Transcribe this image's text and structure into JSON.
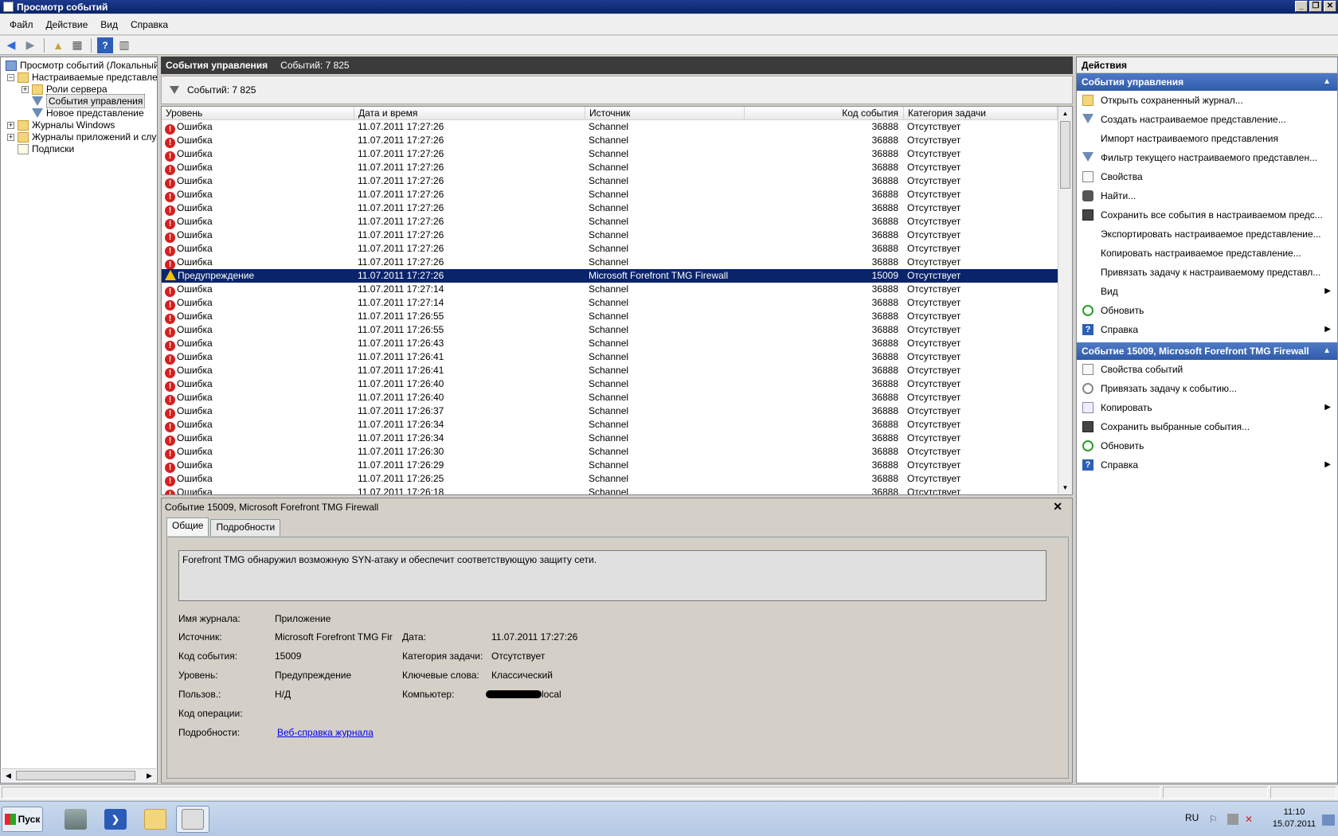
{
  "window": {
    "title": "Просмотр событий"
  },
  "menu": [
    "Файл",
    "Действие",
    "Вид",
    "Справка"
  ],
  "tree": [
    {
      "label": "Просмотр событий (Локальный)",
      "level": 0,
      "expander": "",
      "icon": "computer"
    },
    {
      "label": "Настраиваемые представлени",
      "level": 0,
      "expander": "−",
      "icon": "folder"
    },
    {
      "label": "Роли сервера",
      "level": 1,
      "expander": "+",
      "icon": "folder"
    },
    {
      "label": "События управления",
      "level": 1,
      "expander": "",
      "icon": "filter",
      "selected": true
    },
    {
      "label": "Новое представление",
      "level": 1,
      "expander": "",
      "icon": "filter"
    },
    {
      "label": "Журналы Windows",
      "level": 0,
      "expander": "+",
      "icon": "folder"
    },
    {
      "label": "Журналы приложений и служ",
      "level": 0,
      "expander": "+",
      "icon": "folder"
    },
    {
      "label": "Подписки",
      "level": 0,
      "expander": "",
      "icon": "doc"
    }
  ],
  "center": {
    "header_title": "События управления",
    "header_count": "Событий: 7 825",
    "filter_count": "Событий: 7 825"
  },
  "columns": [
    "Уровень",
    "Дата и время",
    "Источник",
    "Код события",
    "Категория задачи"
  ],
  "events": [
    {
      "level": "Ошибка",
      "datetime": "11.07.2011 17:27:26",
      "source": "Schannel",
      "code": "36888",
      "category": "Отсутствует"
    },
    {
      "level": "Ошибка",
      "datetime": "11.07.2011 17:27:26",
      "source": "Schannel",
      "code": "36888",
      "category": "Отсутствует"
    },
    {
      "level": "Ошибка",
      "datetime": "11.07.2011 17:27:26",
      "source": "Schannel",
      "code": "36888",
      "category": "Отсутствует"
    },
    {
      "level": "Ошибка",
      "datetime": "11.07.2011 17:27:26",
      "source": "Schannel",
      "code": "36888",
      "category": "Отсутствует"
    },
    {
      "level": "Ошибка",
      "datetime": "11.07.2011 17:27:26",
      "source": "Schannel",
      "code": "36888",
      "category": "Отсутствует"
    },
    {
      "level": "Ошибка",
      "datetime": "11.07.2011 17:27:26",
      "source": "Schannel",
      "code": "36888",
      "category": "Отсутствует"
    },
    {
      "level": "Ошибка",
      "datetime": "11.07.2011 17:27:26",
      "source": "Schannel",
      "code": "36888",
      "category": "Отсутствует"
    },
    {
      "level": "Ошибка",
      "datetime": "11.07.2011 17:27:26",
      "source": "Schannel",
      "code": "36888",
      "category": "Отсутствует"
    },
    {
      "level": "Ошибка",
      "datetime": "11.07.2011 17:27:26",
      "source": "Schannel",
      "code": "36888",
      "category": "Отсутствует"
    },
    {
      "level": "Ошибка",
      "datetime": "11.07.2011 17:27:26",
      "source": "Schannel",
      "code": "36888",
      "category": "Отсутствует"
    },
    {
      "level": "Ошибка",
      "datetime": "11.07.2011 17:27:26",
      "source": "Schannel",
      "code": "36888",
      "category": "Отсутствует"
    },
    {
      "level": "Предупреждение",
      "datetime": "11.07.2011 17:27:26",
      "source": "Microsoft Forefront TMG Firewall",
      "code": "15009",
      "category": "Отсутствует",
      "selected": true
    },
    {
      "level": "Ошибка",
      "datetime": "11.07.2011 17:27:14",
      "source": "Schannel",
      "code": "36888",
      "category": "Отсутствует"
    },
    {
      "level": "Ошибка",
      "datetime": "11.07.2011 17:27:14",
      "source": "Schannel",
      "code": "36888",
      "category": "Отсутствует"
    },
    {
      "level": "Ошибка",
      "datetime": "11.07.2011 17:26:55",
      "source": "Schannel",
      "code": "36888",
      "category": "Отсутствует"
    },
    {
      "level": "Ошибка",
      "datetime": "11.07.2011 17:26:55",
      "source": "Schannel",
      "code": "36888",
      "category": "Отсутствует"
    },
    {
      "level": "Ошибка",
      "datetime": "11.07.2011 17:26:43",
      "source": "Schannel",
      "code": "36888",
      "category": "Отсутствует"
    },
    {
      "level": "Ошибка",
      "datetime": "11.07.2011 17:26:41",
      "source": "Schannel",
      "code": "36888",
      "category": "Отсутствует"
    },
    {
      "level": "Ошибка",
      "datetime": "11.07.2011 17:26:41",
      "source": "Schannel",
      "code": "36888",
      "category": "Отсутствует"
    },
    {
      "level": "Ошибка",
      "datetime": "11.07.2011 17:26:40",
      "source": "Schannel",
      "code": "36888",
      "category": "Отсутствует"
    },
    {
      "level": "Ошибка",
      "datetime": "11.07.2011 17:26:40",
      "source": "Schannel",
      "code": "36888",
      "category": "Отсутствует"
    },
    {
      "level": "Ошибка",
      "datetime": "11.07.2011 17:26:37",
      "source": "Schannel",
      "code": "36888",
      "category": "Отсутствует"
    },
    {
      "level": "Ошибка",
      "datetime": "11.07.2011 17:26:34",
      "source": "Schannel",
      "code": "36888",
      "category": "Отсутствует"
    },
    {
      "level": "Ошибка",
      "datetime": "11.07.2011 17:26:34",
      "source": "Schannel",
      "code": "36888",
      "category": "Отсутствует"
    },
    {
      "level": "Ошибка",
      "datetime": "11.07.2011 17:26:30",
      "source": "Schannel",
      "code": "36888",
      "category": "Отсутствует"
    },
    {
      "level": "Ошибка",
      "datetime": "11.07.2011 17:26:29",
      "source": "Schannel",
      "code": "36888",
      "category": "Отсутствует"
    },
    {
      "level": "Ошибка",
      "datetime": "11.07.2011 17:26:25",
      "source": "Schannel",
      "code": "36888",
      "category": "Отсутствует"
    },
    {
      "level": "Ошибка",
      "datetime": "11.07.2011 17:26:18",
      "source": "Schannel",
      "code": "36888",
      "category": "Отсутствует"
    }
  ],
  "details": {
    "title": "Событие 15009, Microsoft Forefront TMG Firewall",
    "tabs": [
      "Общие",
      "Подробности"
    ],
    "message": "Forefront TMG обнаружил возможную SYN-атаку и обеспечит соответствующую защиту сети.",
    "labels": {
      "log_name": "Имя журнала:",
      "source": "Источник:",
      "event_code": "Код события:",
      "level": "Уровень:",
      "user": "Пользов.:",
      "opcode": "Код операции:",
      "more": "Подробности:",
      "date": "Дата:",
      "task_category": "Категория задачи:",
      "keywords": "Ключевые слова:",
      "computer": "Компьютер:"
    },
    "values": {
      "log_name": "Приложение",
      "source": "Microsoft Forefront TMG Fir",
      "event_code": "15009",
      "level": "Предупреждение",
      "user": "Н/Д",
      "opcode": "",
      "more_link": "Веб-справка журнала",
      "date": "11.07.2011 17:27:26",
      "task_category": "Отсутствует",
      "keywords": "Классический",
      "computer_suffix": "local"
    }
  },
  "actions": {
    "title": "Действия",
    "section1": {
      "title": "События управления",
      "items": [
        {
          "label": "Открыть сохраненный журнал...",
          "icon": "folder"
        },
        {
          "label": "Создать настраиваемое представление...",
          "icon": "filter"
        },
        {
          "label": "Импорт настраиваемого представления",
          "icon": ""
        },
        {
          "label": "Фильтр текущего настраиваемого представлен...",
          "icon": "filter"
        },
        {
          "label": "Свойства",
          "icon": "doc"
        },
        {
          "label": "Найти...",
          "icon": "binoc"
        },
        {
          "label": "Сохранить все события в настраиваемом предс...",
          "icon": "save"
        },
        {
          "label": "Экспортировать настраиваемое представление...",
          "icon": ""
        },
        {
          "label": "Копировать настраиваемое представление...",
          "icon": ""
        },
        {
          "label": "Привязать задачу к настраиваемому представл...",
          "icon": ""
        },
        {
          "label": "Вид",
          "icon": "",
          "submenu": true
        },
        {
          "label": "Обновить",
          "icon": "refresh"
        },
        {
          "label": "Справка",
          "icon": "help",
          "submenu": true
        }
      ]
    },
    "section2": {
      "title": "Событие 15009, Microsoft Forefront TMG Firewall",
      "items": [
        {
          "label": "Свойства событий",
          "icon": "doc"
        },
        {
          "label": "Привязать задачу к событию...",
          "icon": "clock"
        },
        {
          "label": "Копировать",
          "icon": "copy",
          "submenu": true
        },
        {
          "label": "Сохранить выбранные события...",
          "icon": "save"
        },
        {
          "label": "Обновить",
          "icon": "refresh"
        },
        {
          "label": "Справка",
          "icon": "help",
          "submenu": true
        }
      ]
    }
  },
  "taskbar": {
    "start_label": "Пуск",
    "lang": "RU",
    "time": "11:10",
    "date": "15.07.2011"
  }
}
